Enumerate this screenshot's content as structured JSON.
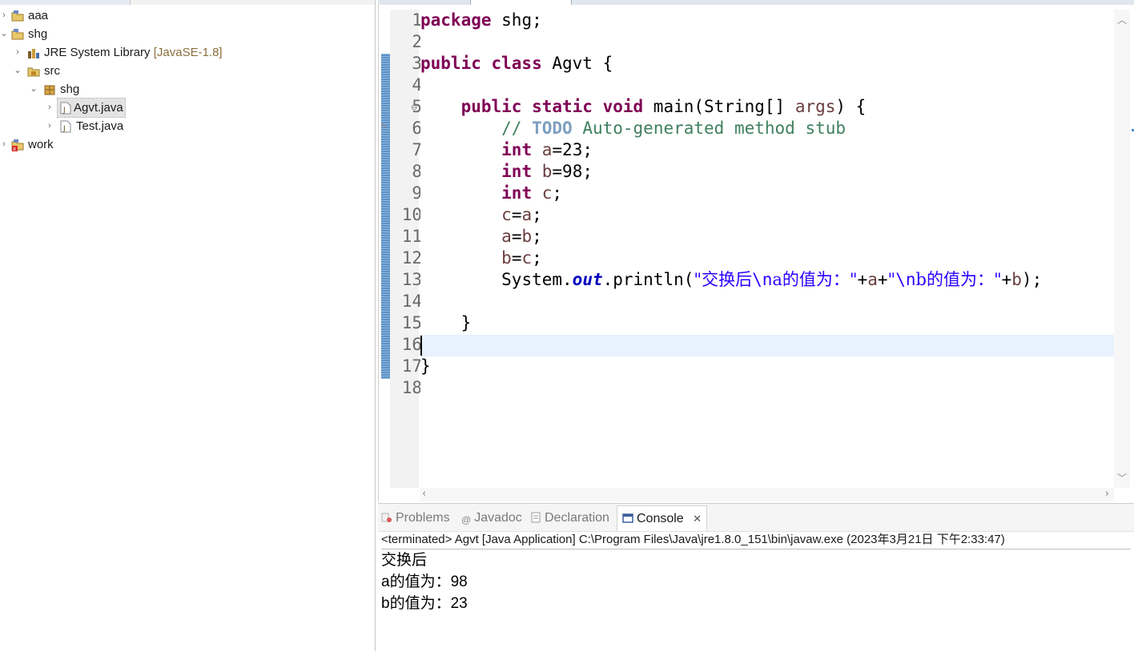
{
  "explorer": {
    "items": [
      {
        "label": "aaa",
        "decoration": ""
      },
      {
        "label": "shg",
        "decoration": ""
      },
      {
        "label": "JRE System Library",
        "decoration": "[JavaSE-1.8]"
      },
      {
        "label": "src",
        "decoration": ""
      },
      {
        "label": "shg",
        "decoration": ""
      },
      {
        "label": "Agvt.java",
        "decoration": ""
      },
      {
        "label": "Test.java",
        "decoration": ""
      },
      {
        "label": "work",
        "decoration": ""
      }
    ]
  },
  "editor": {
    "line_numbers": [
      "1",
      "2",
      "3",
      "4",
      "5",
      "6",
      "7",
      "8",
      "9",
      "10",
      "11",
      "12",
      "13",
      "14",
      "15",
      "16",
      "17",
      "18"
    ],
    "code": {
      "l1_kw": "package",
      "l1_rest": " shg;",
      "l3_kw": "public class",
      "l3_rest": " Agvt {",
      "l5_indent": "    ",
      "l5_kw": "public static void",
      "l5_mid": " main(String[] ",
      "l5_var": "args",
      "l5_end": ") {",
      "l6_indent": "        ",
      "l6_com": "// ",
      "l6_todo": "TODO",
      "l6_rest": " Auto-generated method stub",
      "l7_indent": "        ",
      "l7_kw": "int",
      "l7_sp": " ",
      "l7_var": "a",
      "l7_rest": "=23;",
      "l8_indent": "        ",
      "l8_kw": "int",
      "l8_sp": " ",
      "l8_var": "b",
      "l8_rest": "=98;",
      "l9_indent": "        ",
      "l9_kw": "int",
      "l9_sp": " ",
      "l9_var": "c",
      "l9_rest": ";",
      "l10_indent": "        ",
      "l10_v1": "c",
      "l10_eq": "=",
      "l10_v2": "a",
      "l10_end": ";",
      "l11_indent": "        ",
      "l11_v1": "a",
      "l11_eq": "=",
      "l11_v2": "b",
      "l11_end": ";",
      "l12_indent": "        ",
      "l12_v1": "b",
      "l12_eq": "=",
      "l12_v2": "c",
      "l12_end": ";",
      "l13_indent": "        ",
      "l13_sys": "System.",
      "l13_fld": "out",
      "l13_call": ".println(",
      "l13_s1": "\"交换后",
      "l13_e1": "\\n",
      "l13_s2": "a的值为：\"",
      "l13_plus1": "+",
      "l13_va": "a",
      "l13_plus2": "+",
      "l13_s3": "\"",
      "l13_e2": "\\n",
      "l13_s4": "b的值为：\"",
      "l13_plus3": "+",
      "l13_vb": "b",
      "l13_end": ");",
      "l15_indent": "    ",
      "l15_brace": "}",
      "l17_brace": "}"
    }
  },
  "console": {
    "tabs": [
      "Problems",
      "Javadoc",
      "Declaration",
      "Console"
    ],
    "active_tab": "Console",
    "close_glyph": "✕",
    "header": "<terminated> Agvt [Java Application] C:\\Program Files\\Java\\jre1.8.0_151\\bin\\javaw.exe (2023年3月21日 下午2:33:47)",
    "output": [
      "交换后",
      "a的值为：98",
      "b的值为：23"
    ]
  },
  "colors": {
    "keyword": "#7f0055",
    "comment": "#3f7f5f",
    "string": "#2a00ff",
    "field": "#0000c0",
    "local_var": "#6a3e3e",
    "current_line": "#e8f2fe"
  }
}
